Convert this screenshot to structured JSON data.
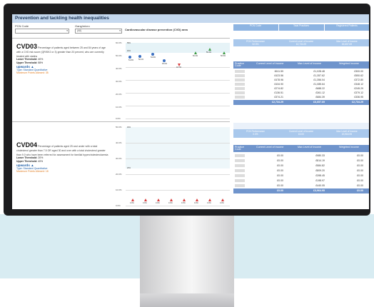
{
  "dashboard": {
    "title": "Prevention and tackling health inequalities",
    "filters": [
      {
        "label": "PCN Code",
        "value": ""
      },
      {
        "label": "Gang/micro",
        "value": "(All)"
      }
    ],
    "chart_title": "Cardiovascular disease prevention (CVD) area"
  },
  "indicators": [
    {
      "code": "CVD03",
      "description": "Percentage of patients aged between 25 and 84 years of age with a CVD risk score (QRISK2 or 3) greater than 20 percent, who are currently treated with statins",
      "lower_label": "Lower Threshold:",
      "lower_value": "40%",
      "upper_label": "Upper Threshold:",
      "upper_value": "58%",
      "direction": "upwards",
      "type": "Type: Standard Quantitative",
      "max_points": "Maximum Points Allowed: 35",
      "y_ticks": [
        "60.0%",
        "50.0%",
        "40.0%",
        "30.0%",
        "20.0%",
        "10.0%",
        "0.0%"
      ],
      "band_labels": [
        "58%",
        "40%"
      ],
      "point_labels": [
        "51.8%",
        "50.0%",
        "54.8%",
        "45.0%",
        "43.7%",
        "56.3%",
        "59.3%",
        "56.5%"
      ]
    },
    {
      "code": "CVD04",
      "description": "Percentage of patients aged 25 and under with a total cholesterol greater than 7.5 OR aged 30 and over with a total cholesterol greater than 9.0 who have been referred for assessment for familial hypercholesterolaemia",
      "lower_label": "Lower Threshold:",
      "lower_value": "20%",
      "upper_label": "Upper Threshold:",
      "upper_value": "40%",
      "direction": "upwards",
      "type": "Type: Standard Quantitative",
      "max_points": "Maximum Points Allowed: 18",
      "y_ticks": [
        "50.0%",
        "40.0%",
        "30.0%",
        "20.0%",
        "10.0%",
        "0.0%"
      ],
      "band_labels": [
        "40%",
        "20%"
      ],
      "point_labels": [
        "0.0%",
        "0.0%",
        "0.0%",
        "0.0%",
        "0.0%",
        "0.0%",
        "0.0%",
        "0.0%"
      ]
    }
  ],
  "tables": [
    {
      "top_headers": [
        "PCN Code",
        "Total Practices",
        "Registered Patients"
      ],
      "sub_headers": [
        {
          "label": "PCN Performance",
          "value": "52.5%"
        },
        {
          "label": "Current Level of Income",
          "value": "£2,734.29"
        },
        {
          "label": "Max Level of Income",
          "value": "£6,657.69"
        }
      ],
      "columns": [
        "Practice Code",
        "Current Level of Income",
        "Max Level of Income",
        "Weighted Income"
      ],
      "rows": [
        [
          "£611.59",
          "£1,028.48",
          "£300.00"
        ],
        [
          "£423.56",
          "£1,357.62",
          "£550.62"
        ],
        [
          "£478.96",
          "£1,356.04",
          "£372.80"
        ],
        [
          "£434.90",
          "£1,085.64",
          "£348.12"
        ],
        [
          "£274.82",
          "£688.22",
          "£245.29"
        ],
        [
          "£136.51",
          "£361.12",
          "£379.12"
        ],
        [
          "£374.21",
          "£684.39",
          "£336.95"
        ]
      ],
      "totals": [
        "£2,734.29",
        "£6,657.69",
        "£2,734.29"
      ]
    },
    {
      "top_headers": [
        "",
        "",
        ""
      ],
      "sub_headers": [
        {
          "label": "PCN Performance",
          "value": "0.0%"
        },
        {
          "label": "Current Level of Income",
          "value": "£0.00"
        },
        {
          "label": "Max Level of Income",
          "value": "£3,964.95"
        }
      ],
      "columns": [
        "Practice Code",
        "Current Level of Income",
        "Max Level of Income",
        "Weighted Income"
      ],
      "rows": [
        [
          "£0.00",
          "£980.33",
          "£0.00"
        ],
        [
          "£0.00",
          "£814.19",
          "£0.00"
        ],
        [
          "£0.00",
          "£584.82",
          "£0.00"
        ],
        [
          "£0.00",
          "£809.20",
          "£0.00"
        ],
        [
          "£0.00",
          "£398.45",
          "£0.00"
        ],
        [
          "£0.00",
          "£198.97",
          "£0.00"
        ],
        [
          "£0.00",
          "£440.05",
          "£0.00"
        ]
      ],
      "totals": [
        "£0.00",
        "£3,964.95",
        "£0.00"
      ]
    }
  ]
}
